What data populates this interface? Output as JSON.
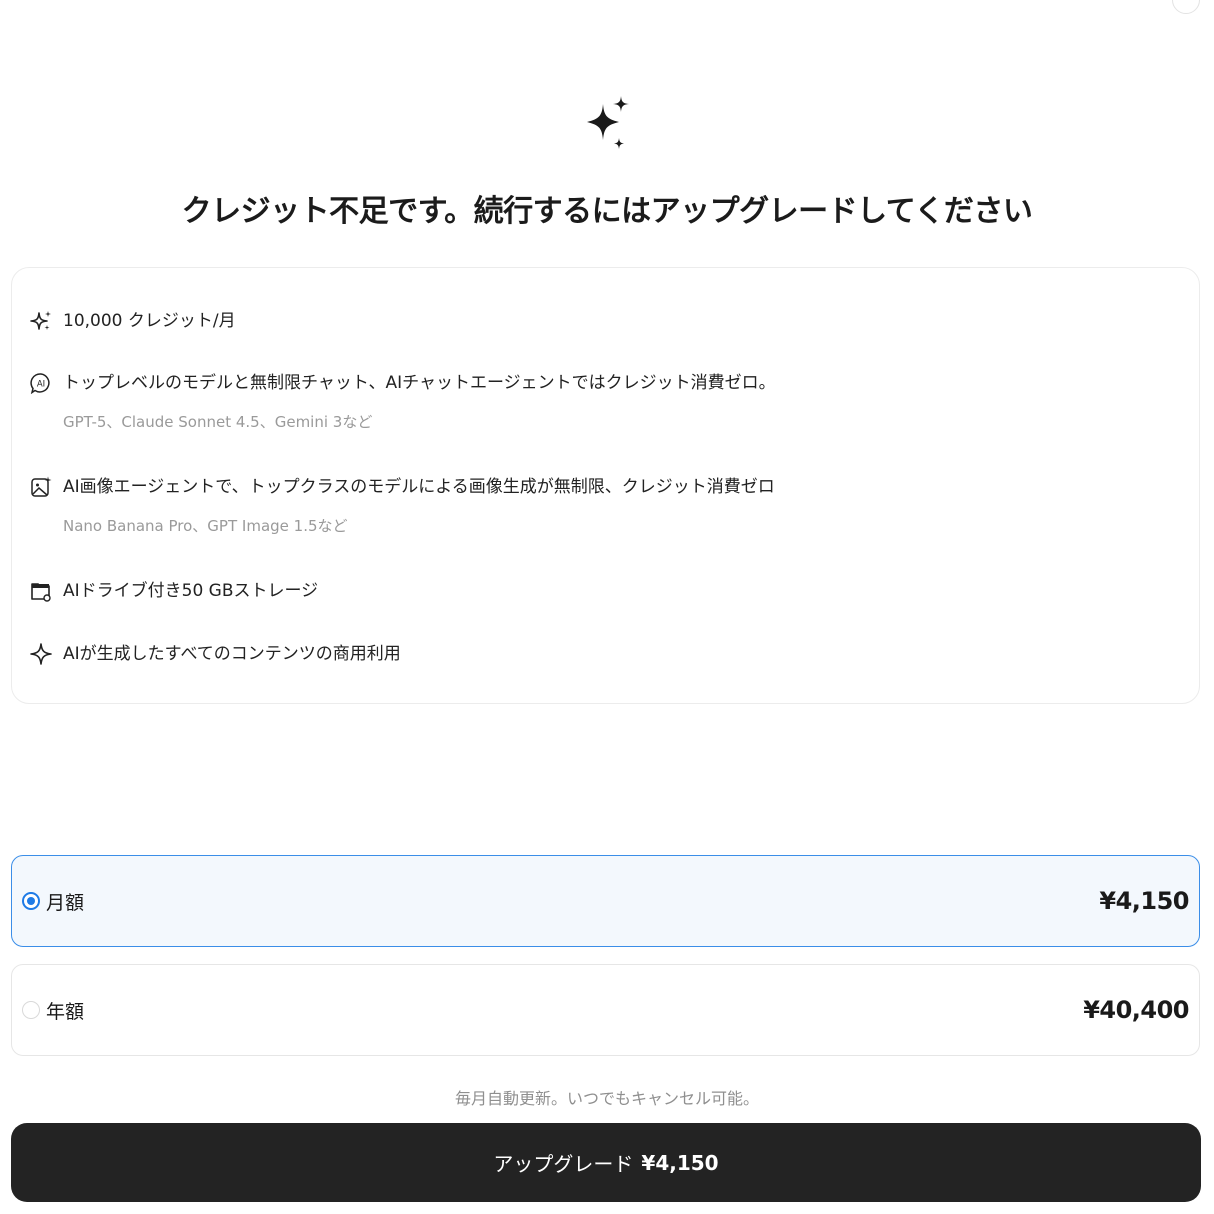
{
  "title": "クレジット不足です。続行するにはアップグレードしてください",
  "features": [
    {
      "icon": "sparkles-icon",
      "text": "10,000 クレジット/月",
      "sub": ""
    },
    {
      "icon": "ai-chat-icon",
      "text": "トップレベルのモデルと無制限チャット、AIチャットエージェントではクレジット消費ゼロ。",
      "sub": "GPT-5、Claude Sonnet 4.5、Gemini 3など"
    },
    {
      "icon": "ai-image-icon",
      "text": "AI画像エージェントで、トップクラスのモデルによる画像生成が無制限、クレジット消費ゼロ",
      "sub": "Nano Banana Pro、GPT Image 1.5など"
    },
    {
      "icon": "drive-folder-icon",
      "text": "AIドライブ付き50 GBストレージ",
      "sub": ""
    },
    {
      "icon": "sparkle-icon",
      "text": "AIが生成したすべてのコンテンツの商用利用",
      "sub": ""
    }
  ],
  "plans": [
    {
      "label": "月額",
      "price": "¥4,150",
      "selected": true
    },
    {
      "label": "年額",
      "price": "¥40,400",
      "selected": false
    }
  ],
  "renew_note": "毎月自動更新。いつでもキャンセル可能。",
  "upgrade": {
    "label": "アップグレード",
    "price": "¥4,150"
  },
  "colors": {
    "accent": "#1e7be6",
    "button_bg": "#232323",
    "selected_bg": "#f3f8fd"
  }
}
